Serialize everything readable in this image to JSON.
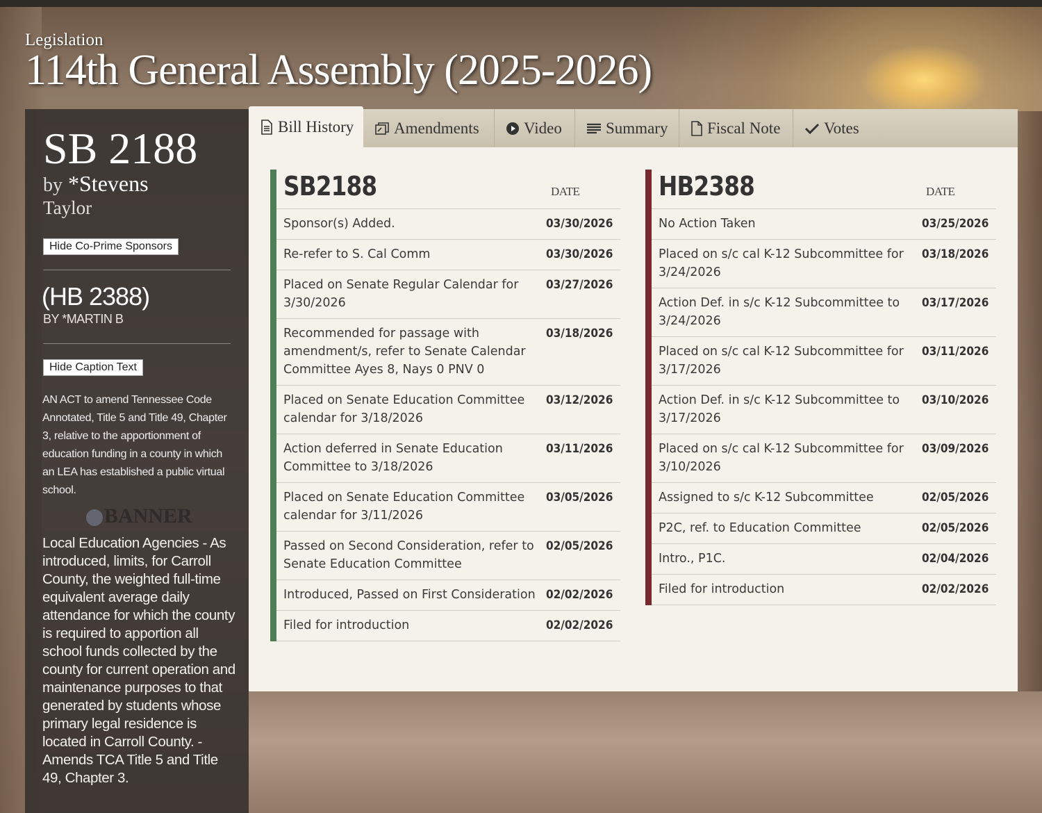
{
  "page": {
    "kicker": "Legislation",
    "title": "114th General Assembly (2025-2026)"
  },
  "sidebar": {
    "bill_number": "SB 2188",
    "by_label": "by",
    "sponsor": "*Stevens",
    "cosponsor": "Taylor",
    "hide_cosponsors_label": "Hide Co-Prime Sponsors",
    "companion_bill": "(HB 2388)",
    "companion_sponsor": "BY *MARTIN B",
    "hide_caption_label": "Hide Caption Text",
    "caption": "AN ACT to amend Tennessee Code Annotated, Title 5 and Title 49, Chapter 3, relative to the apportionment of education funding in a county in which an LEA has established a public virtual school.",
    "summary": "Local Education Agencies - As introduced, limits, for Carroll County, the weighted full-time equivalent average daily attendance for which the county is required to apportion all school funds collected by the county for current operation and maintenance purposes to that generated by students whose primary legal residence is located in Carroll County. - Amends TCA Title 5 and Title 49, Chapter 3.",
    "watermark": "BANNER"
  },
  "tabs": [
    {
      "label": "Bill History",
      "icon": "document-icon"
    },
    {
      "label": "Amendments",
      "icon": "amendments-icon"
    },
    {
      "label": "Video",
      "icon": "play-icon"
    },
    {
      "label": "Summary",
      "icon": "list-icon"
    },
    {
      "label": "Fiscal Note",
      "icon": "file-icon"
    },
    {
      "label": "Votes",
      "icon": "check-icon"
    }
  ],
  "senate_history": {
    "title": "SB2188",
    "date_header": "DATE",
    "rows": [
      {
        "action": "Sponsor(s) Added.",
        "date": "03/30/2026"
      },
      {
        "action": "Re-refer to S. Cal Comm",
        "date": "03/30/2026"
      },
      {
        "action": "Placed on Senate Regular Calendar for 3/30/2026",
        "date": "03/27/2026"
      },
      {
        "action": "Recommended for passage with amendment/s, refer to Senate Calendar Committee Ayes 8, Nays 0 PNV 0",
        "date": "03/18/2026"
      },
      {
        "action": "Placed on Senate Education Committee calendar for 3/18/2026",
        "date": "03/12/2026"
      },
      {
        "action": "Action deferred in Senate Education Committee to 3/18/2026",
        "date": "03/11/2026"
      },
      {
        "action": "Placed on Senate Education Committee calendar for 3/11/2026",
        "date": "03/05/2026"
      },
      {
        "action": "Passed on Second Consideration, refer to Senate Education Committee",
        "date": "02/05/2026"
      },
      {
        "action": "Introduced, Passed on First Consideration",
        "date": "02/02/2026"
      },
      {
        "action": "Filed for introduction",
        "date": "02/02/2026"
      }
    ]
  },
  "house_history": {
    "title": "HB2388",
    "date_header": "DATE",
    "rows": [
      {
        "action": "No Action Taken",
        "date": "03/25/2026"
      },
      {
        "action": "Placed on s/c cal K-12 Subcommittee for 3/24/2026",
        "date": "03/18/2026"
      },
      {
        "action": "Action Def. in s/c K-12 Subcommittee to 3/24/2026",
        "date": "03/17/2026"
      },
      {
        "action": "Placed on s/c cal K-12 Subcommittee for 3/17/2026",
        "date": "03/11/2026"
      },
      {
        "action": "Action Def. in s/c K-12 Subcommittee to 3/17/2026",
        "date": "03/10/2026"
      },
      {
        "action": "Placed on s/c cal K-12 Subcommittee for 3/10/2026",
        "date": "03/09/2026"
      },
      {
        "action": "Assigned to s/c K-12 Subcommittee",
        "date": "02/05/2026"
      },
      {
        "action": "P2C, ref. to Education Committee",
        "date": "02/05/2026"
      },
      {
        "action": "Intro., P1C.",
        "date": "02/04/2026"
      },
      {
        "action": "Filed for introduction",
        "date": "02/02/2026"
      }
    ]
  },
  "colors": {
    "senate_accent": "#4f7d55",
    "house_accent": "#7a2a2e",
    "panel_bg": "#f4f2ea",
    "sidebar_bg": "#322f2d"
  }
}
